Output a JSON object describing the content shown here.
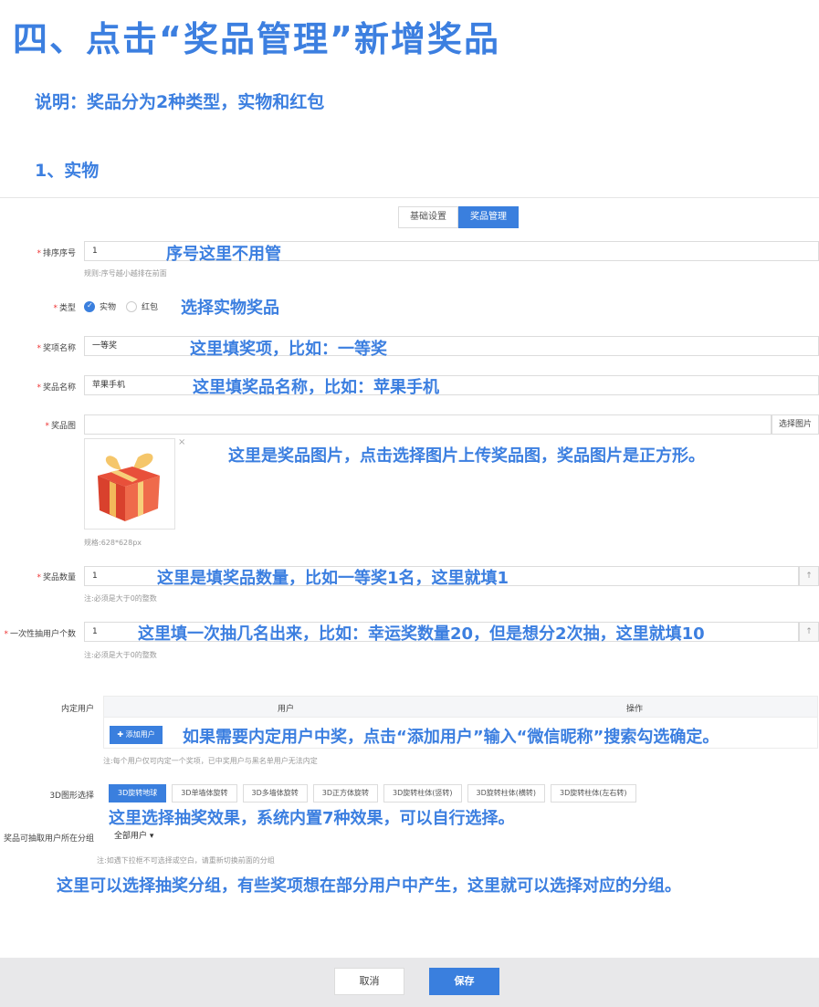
{
  "annotation": {
    "title": "四、点击“奖品管理”新增奖品",
    "description": "说明：奖品分为2种类型，实物和红包",
    "subtitle": "1、实物",
    "notes": {
      "sort": "序号这里不用管",
      "type": "选择实物奖品",
      "item": "这里填奖项，比如：一等奖",
      "name": "这里填奖品名称，比如：苹果手机",
      "image": "这里是奖品图片，点击选择图片上传奖品图，奖品图片是正方形。",
      "quantity": "这里是填奖品数量，比如一等奖1名，这里就填1",
      "per_draw": "这里填一次抽几名出来，比如：幸运奖数量20，但是想分2次抽，这里就填10",
      "internal": "如果需要内定用户中奖，点击“添加用户”输入“微信昵称”搜索勾选确定。",
      "effect": "这里选择抽奖效果，系统内置7种效果，可以自行选择。",
      "group": "这里可以选择抽奖分组，有些奖项想在部分用户中产生，这里就可以选择对应的分组。"
    }
  },
  "tabs": [
    "基础设置",
    "奖品管理"
  ],
  "form": {
    "required_mark": "*",
    "sort_label": "排序序号",
    "sort_value": "1",
    "sort_hint": "规则:序号越小越排在前面",
    "type_label": "类型",
    "type_options": [
      "实物",
      "红包"
    ],
    "item_label": "奖项名称",
    "item_value": "一等奖",
    "name_label": "奖品名称",
    "name_value": "苹果手机",
    "image_label": "奖品图",
    "image_button": "选择图片",
    "image_close": "×",
    "image_hint": "规格:628*628px",
    "quantity_label": "奖品数量",
    "quantity_value": "1",
    "quantity_hint": "注:必须是大于0的整数",
    "per_draw_label": "一次性抽用户个数",
    "per_draw_value": "1",
    "per_draw_hint": "注:必须是大于0的整数",
    "stepper_glyph": "↑",
    "internal_label": "内定用户",
    "table_headers": [
      "用户",
      "操作"
    ],
    "add_user_button": "✚ 添加用户",
    "internal_hint": "注:每个用户仅可内定一个奖项，已中奖用户与黑名单用户无法内定",
    "effect_label": "3D图形选择",
    "effects": [
      "3D旋转地球",
      "3D单墙体旋转",
      "3D多墙体旋转",
      "3D正方体旋转",
      "3D旋转柱体(竖转)",
      "3D旋转柱体(横转)",
      "3D旋转柱体(左右转)"
    ],
    "group_label": "奖品可抽取用户所在分组",
    "group_value": "全部用户 ▾",
    "group_hint": "注:如遇下拉框不可选择或空白，请重新切换前面的分组"
  },
  "footer": {
    "cancel": "取消",
    "save": "保存"
  },
  "colors": {
    "accent": "#3a7fde",
    "annotation": "#3c7fe0"
  }
}
